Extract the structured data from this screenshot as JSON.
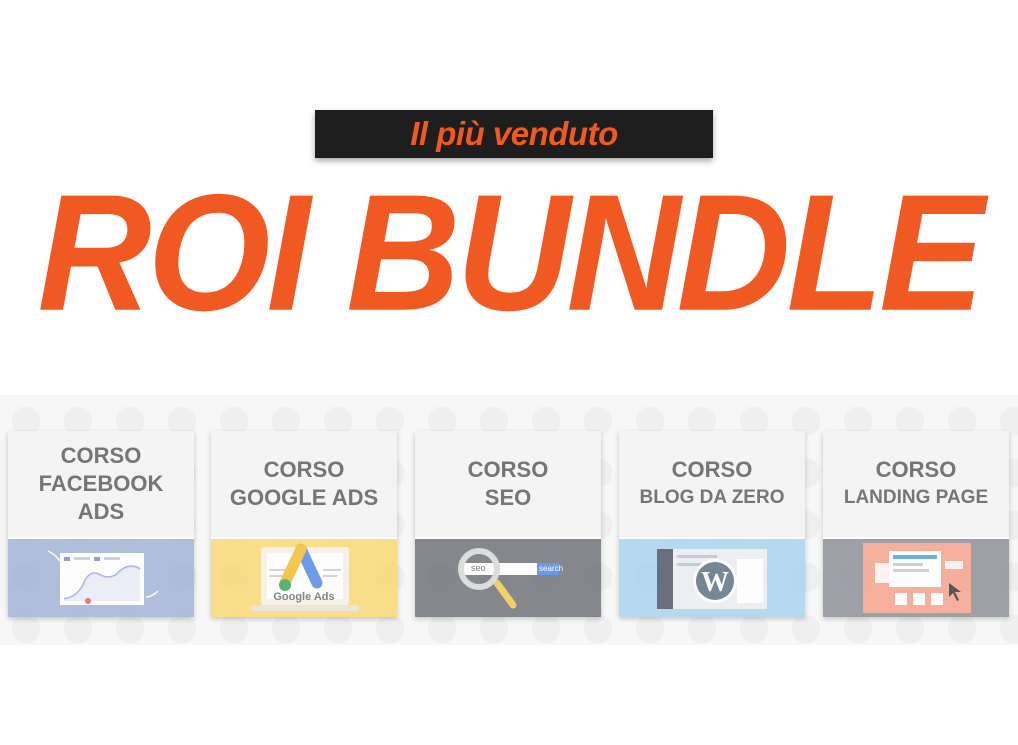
{
  "badge": {
    "text": "Il più venduto"
  },
  "title": {
    "text": "ROI BUNDLE"
  },
  "cards": [
    {
      "line1": "CORSO",
      "line2": "FACEBOOK",
      "line3": "ADS",
      "color": "#9fb2d6"
    },
    {
      "line1": "CORSO",
      "line2": "GOOGLE ADS",
      "color": "#f9d970"
    },
    {
      "line1": "CORSO",
      "line2": "SEO",
      "color": "#6b6f75"
    },
    {
      "line1": "CORSO",
      "line2": "BLOG DA ZERO",
      "color": "#a7d3ee"
    },
    {
      "line1": "CORSO",
      "line2": "LANDING PAGE",
      "color": "#8a8f96"
    }
  ],
  "seo_box": {
    "input": "seo",
    "button": "search"
  },
  "google_ads_caption": "Google Ads",
  "colors": {
    "accent": "#f05a22",
    "badge_bg": "#1e1e1e"
  }
}
